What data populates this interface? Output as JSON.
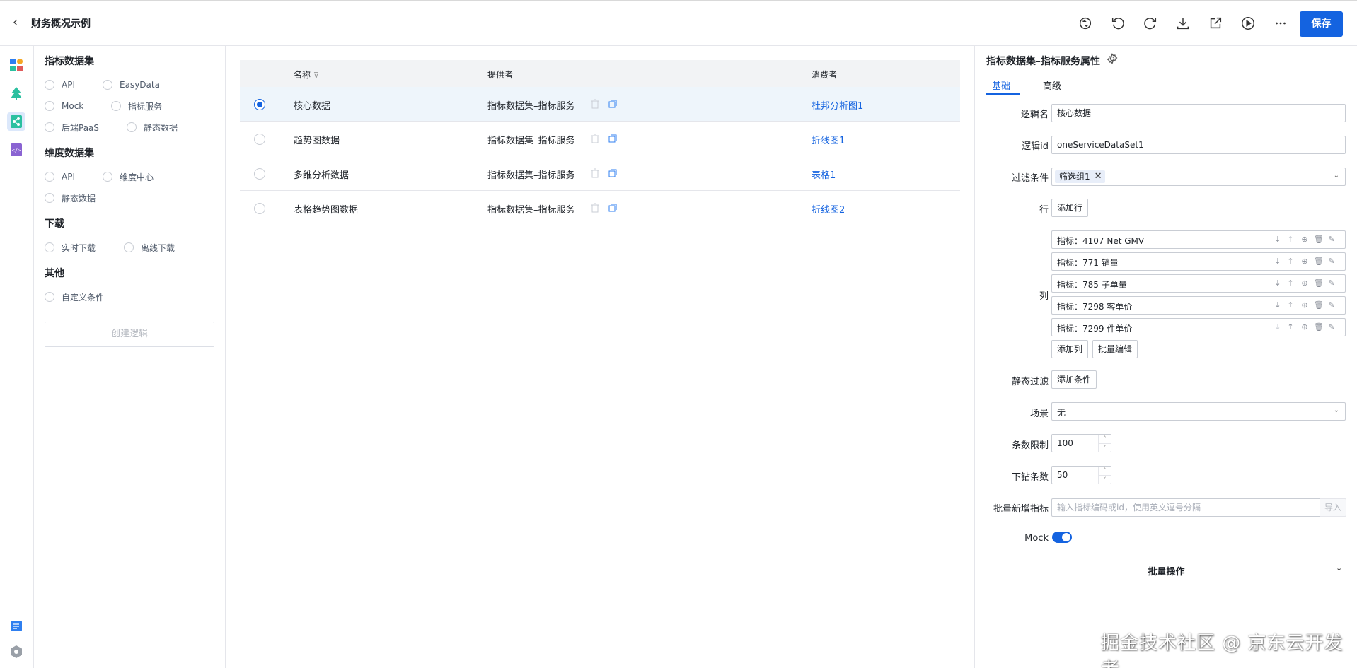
{
  "header": {
    "title": "财务概况示例",
    "save_label": "保存",
    "icons": [
      "sync-icon",
      "undo-icon",
      "redo-icon",
      "download-icon",
      "export-icon",
      "play-icon",
      "more-icon"
    ]
  },
  "rail": {
    "items": [
      "components-icon",
      "tree-icon",
      "dataset-icon",
      "code-icon"
    ],
    "bottom": [
      "book-icon",
      "settings-icon"
    ]
  },
  "left_panel": {
    "sections": [
      {
        "title": "指标数据集",
        "options": [
          "API",
          "EasyData",
          "Mock",
          "指标服务",
          "后端PaaS",
          "静态数据"
        ]
      },
      {
        "title": "维度数据集",
        "options": [
          "API",
          "维度中心",
          "静态数据"
        ]
      },
      {
        "title": "下载",
        "options": [
          "实时下载",
          "离线下载"
        ]
      },
      {
        "title": "其他",
        "options": [
          "自定义条件"
        ]
      }
    ],
    "create_label": "创建逻辑"
  },
  "table": {
    "headers": {
      "name": "名称",
      "provider": "提供者",
      "consumer": "消费者"
    },
    "rows": [
      {
        "name": "核心数据",
        "provider": "指标数据集–指标服务",
        "consumer": "杜邦分析图1",
        "selected": true
      },
      {
        "name": "趋势图数据",
        "provider": "指标数据集–指标服务",
        "consumer": "折线图1",
        "selected": false
      },
      {
        "name": "多维分析数据",
        "provider": "指标数据集–指标服务",
        "consumer": "表格1",
        "selected": false
      },
      {
        "name": "表格趋势图数据",
        "provider": "指标数据集–指标服务",
        "consumer": "折线图2",
        "selected": false
      }
    ]
  },
  "props": {
    "title": "指标数据集–指标服务属性",
    "tabs": [
      "基础",
      "高级"
    ],
    "labels": {
      "logic_name": "逻辑名",
      "logic_id": "逻辑id",
      "filter": "过滤条件",
      "row": "行",
      "col": "列",
      "static_filter": "静态过滤",
      "scene": "场景",
      "limit": "条数限制",
      "drill": "下钻条数",
      "batch_add": "批量新增指标",
      "mock": "Mock"
    },
    "logic_name_value": "核心数据",
    "logic_id_value": "oneServiceDataSet1",
    "filter_tag": "筛选组1",
    "add_row_label": "添加行",
    "columns": [
      "指标：4107 Net GMV",
      "指标：771 销量",
      "指标：785 子单量",
      "指标：7298 客单价",
      "指标：7299 件单价"
    ],
    "add_col_label": "添加列",
    "batch_edit_label": "批量编辑",
    "add_condition_label": "添加条件",
    "scene_value": "无",
    "limit_value": "100",
    "drill_value": "50",
    "batch_placeholder": "输入指标编码或id，使用英文逗号分隔",
    "import_label": "导入",
    "mock_on": true,
    "batch_ops_label": "批量操作"
  },
  "watermark": "掘金技术社区 @ 京东云开发者"
}
